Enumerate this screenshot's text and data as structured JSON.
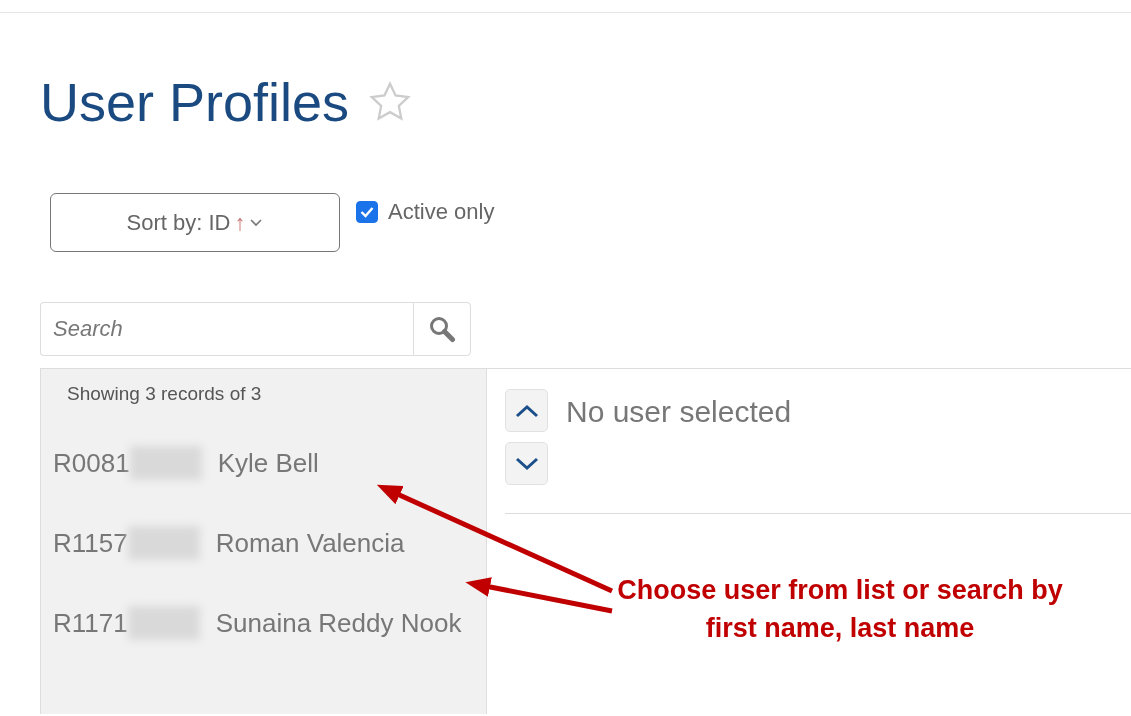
{
  "title": "User Profiles",
  "favorite": false,
  "sort_button": {
    "label": "Sort by: ID",
    "arrow": "↑"
  },
  "active_only": {
    "label": "Active only",
    "checked": true
  },
  "search": {
    "placeholder": "Search"
  },
  "list": {
    "summary": "Showing 3 records of 3",
    "rows": [
      {
        "id": "R0081",
        "name": "Kyle Bell"
      },
      {
        "id": "R1157",
        "name": "Roman Valencia"
      },
      {
        "id": "R1171",
        "name": "Sunaina Reddy Nook"
      }
    ]
  },
  "detail": {
    "message": "No user selected"
  },
  "annotation": {
    "text": "Choose user from list or search by first name, last name"
  }
}
